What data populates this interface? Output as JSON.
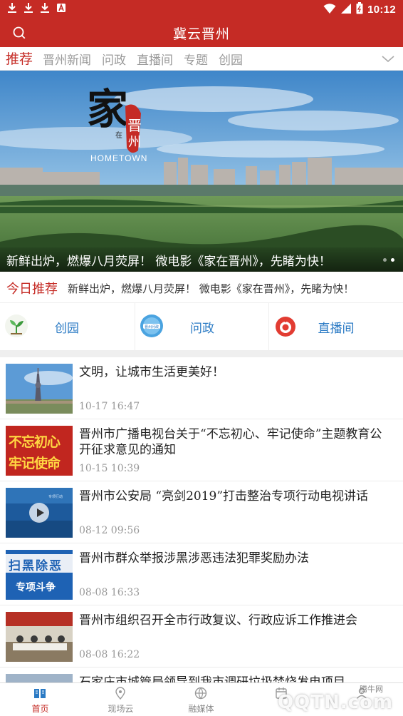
{
  "status_bar": {
    "time": "10:12",
    "left_icons": [
      "download-icon",
      "download-icon",
      "download-icon",
      "notification-a-icon"
    ],
    "right_icons": [
      "wifi-icon",
      "cell-signal-icon",
      "battery-icon"
    ]
  },
  "header": {
    "title": "冀云晋州",
    "search_icon": "search-icon"
  },
  "tabs": {
    "items": [
      {
        "label": "推荐",
        "active": true
      },
      {
        "label": "晋州新闻",
        "active": false
      },
      {
        "label": "问政",
        "active": false
      },
      {
        "label": "直播间",
        "active": false
      },
      {
        "label": "专题",
        "active": false
      },
      {
        "label": "创园",
        "active": false
      }
    ],
    "more_icon": "chevron-down-icon"
  },
  "banner": {
    "logo_text": "家在晋州",
    "logo_sub": "HOMETOWN",
    "caption": "新鲜出炉，燃爆八月荧屏！  微电影《家在晋州》，先睹为快！",
    "slides": 2,
    "active_slide": 2
  },
  "today": {
    "label": "今日推荐",
    "text": "新鲜出炉，燃爆八月荧屏！  微电影《家在晋州》，先睹为快！"
  },
  "quick_links": [
    {
      "label": "创园",
      "icon": "sprout-icon"
    },
    {
      "label": "问政",
      "icon": "wenzheng-badge-icon"
    },
    {
      "label": "直播间",
      "icon": "live-camera-icon"
    }
  ],
  "news": [
    {
      "title": "文明，让城市生活更美好！",
      "time": "10-17  16:47",
      "thumb": "tower-photo"
    },
    {
      "title": "晋州市广播电视台关于“不忘初心、牢记使命”主题教育公开征求意见的通知",
      "time": "10-15  10:39",
      "thumb_text": [
        "不忘初心",
        "牢记使命"
      ]
    },
    {
      "title": "晋州市公安局 “亮剑2019”打击整治专项行动电视讲话",
      "time": "08-12  09:56",
      "thumb": "video-thumb"
    },
    {
      "title": "晋州市群众举报涉黑涉恶违法犯罪奖励办法",
      "time": "08-08  16:33",
      "thumb_text": [
        "扫黑除恶",
        "专项斗争"
      ]
    },
    {
      "title": "晋州市组织召开全市行政复议、行政应诉工作推进会",
      "time": "08-08  16:22",
      "thumb": "meeting-photo"
    },
    {
      "title": "石家庄市城管局领导到我市调研垃圾焚烧发电项目",
      "time": "",
      "thumb": "partial"
    }
  ],
  "bottom_nav": [
    {
      "label": "首页",
      "icon": "book-icon",
      "active": true
    },
    {
      "label": "现场云",
      "icon": "location-pin-icon",
      "active": false
    },
    {
      "label": "融媒体",
      "icon": "globe-icon",
      "active": false
    },
    {
      "label": "",
      "icon": "calendar-icon",
      "active": false
    },
    {
      "label": "",
      "icon": "user-icon",
      "active": false
    }
  ],
  "watermark": {
    "text": "QQTN.com",
    "small": "腾牛网"
  },
  "colors": {
    "brand_red": "#c52b25",
    "link_blue": "#2a7ac4",
    "muted": "#9a9a9a"
  }
}
